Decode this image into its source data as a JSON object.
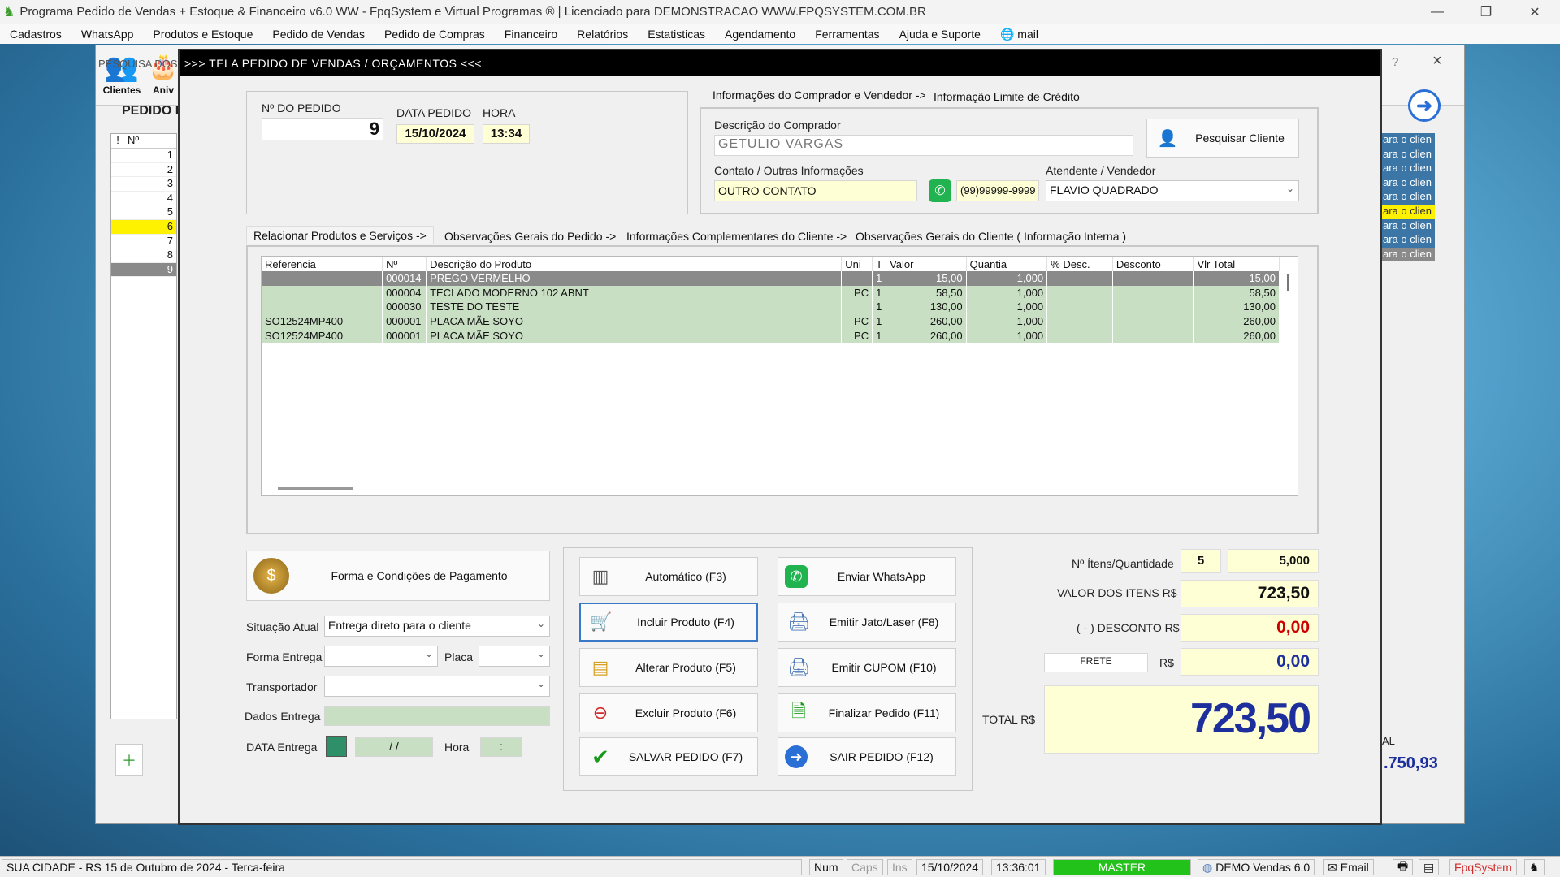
{
  "app": {
    "title": "Programa Pedido de Vendas + Estoque & Financeiro v6.0 WW - FpqSystem e Virtual Programas ® | Licenciado para  DEMONSTRACAO WWW.FPQSYSTEM.COM.BR",
    "menu": [
      "Cadastros",
      "WhatsApp",
      "Produtos e Estoque",
      "Pedido de Vendas",
      "Pedido de Compras",
      "Financeiro",
      "Relatórios",
      "Estatisticas",
      "Agendamento",
      "Ferramentas",
      "Ajuda e Suporte",
      "mail"
    ]
  },
  "background_window": {
    "toolbar": {
      "clientes": "Clientes",
      "aniv": "Aniv"
    },
    "search_label": "PESQUISA DOS",
    "pedido_label": "PEDIDO D",
    "list_header": [
      "!",
      "Nº"
    ],
    "list_numbers": [
      "1",
      "2",
      "3",
      "4",
      "5",
      "6",
      "7",
      "8",
      "9"
    ],
    "right_list": [
      "ara o clien",
      "ara o clien",
      "ara o clien",
      "ara o clien",
      "ara o clien",
      "ara o clien",
      "ara o clien",
      "ara o clien",
      "ara o clien"
    ],
    "total_label": "AL",
    "total_value": ".750,93",
    "help": "?",
    "close": "×"
  },
  "dialog": {
    "title": ">>>   TELA PEDIDO DE VENDAS / ORÇAMENTOS   <<<",
    "order": {
      "num_label": "Nº DO PEDIDO",
      "num_value": "9",
      "date_label": "DATA PEDIDO",
      "date_value": "15/10/2024",
      "hour_label": "HORA",
      "hour_value": "13:34"
    },
    "buyer_tabs": [
      "Informações do Comprador e Vendedor ->",
      "Informação Limite de Crédito"
    ],
    "buyer": {
      "desc_label": "Descrição do Comprador",
      "desc_value": "GETULIO VARGAS",
      "search_btn": "Pesquisar Cliente",
      "contact_label": "Contato / Outras Informações",
      "contact_value": "OUTRO CONTATO",
      "phone": "(99)99999-9999",
      "seller_label": "Atendente / Vendedor",
      "seller_value": "FLAVIO QUADRADO"
    },
    "tabs": [
      "Relacionar Produtos e Serviços ->",
      "Observações Gerais do Pedido ->",
      "Informações Complementares do Cliente ->",
      "Observações Gerais do Cliente ( Informação Interna )"
    ],
    "grid": {
      "columns": [
        "Referencia",
        "Nº",
        "Descrição do Produto",
        "Uni",
        "T",
        "Valor",
        "Quantia",
        "% Desc.",
        "Desconto",
        "Vlr Total"
      ],
      "rows": [
        {
          "ref": "",
          "num": "000014",
          "desc": "PREGO VERMELHO",
          "uni": "",
          "t": "1",
          "valor": "15,00",
          "qtd": "1,000",
          "pdesc": "",
          "desconto": "",
          "total": "15,00"
        },
        {
          "ref": "",
          "num": "000004",
          "desc": "TECLADO MODERNO 102 ABNT",
          "uni": "PC",
          "t": "1",
          "valor": "58,50",
          "qtd": "1,000",
          "pdesc": "",
          "desconto": "",
          "total": "58,50"
        },
        {
          "ref": "",
          "num": "000030",
          "desc": "TESTE DO TESTE",
          "uni": "",
          "t": "1",
          "valor": "130,00",
          "qtd": "1,000",
          "pdesc": "",
          "desconto": "",
          "total": "130,00"
        },
        {
          "ref": "SO12524MP400",
          "num": "000001",
          "desc": "PLACA MÃE SOYO",
          "uni": "PC",
          "t": "1",
          "valor": "260,00",
          "qtd": "1,000",
          "pdesc": "",
          "desconto": "",
          "total": "260,00"
        },
        {
          "ref": "SO12524MP400",
          "num": "000001",
          "desc": "PLACA MÃE SOYO",
          "uni": "PC",
          "t": "1",
          "valor": "260,00",
          "qtd": "1,000",
          "pdesc": "",
          "desconto": "",
          "total": "260,00"
        }
      ]
    },
    "payment": {
      "btn": "Forma e Condições de Pagamento",
      "situacao_label": "Situação Atual",
      "situacao_value": "Entrega direto para o cliente",
      "forma_label": "Forma Entrega",
      "forma_value": "",
      "placa_label": "Placa",
      "placa_value": "",
      "transp_label": "Transportador",
      "transp_value": "",
      "dados_label": "Dados Entrega",
      "data_label": "DATA Entrega",
      "data_value": " / /",
      "hora_label": "Hora",
      "hora_value": ":"
    },
    "actions": {
      "auto": "Automático   (F3)",
      "incluir": "Incluir Produto  (F4)",
      "alterar": "Alterar Produto   (F5)",
      "excluir": "Excluir Produto   (F6)",
      "salvar": "SALVAR PEDIDO (F7)",
      "whatsapp": "Enviar WhatsApp",
      "jato": "Emitir Jato/Laser (F8)",
      "cupom": "Emitir CUPOM   (F10)",
      "finalizar": "Finalizar Pedido  (F11)",
      "sair": "SAIR  PEDIDO   (F12)"
    },
    "totals": {
      "itens_label": "Nº Ítens/Quantidade",
      "itens_count": "5",
      "itens_qty": "5,000",
      "valor_label": "VALOR DOS ITENS R$",
      "valor_value": "723,50",
      "desconto_label": "( - ) DESCONTO R$",
      "desconto_value": "0,00",
      "frete_label": "FRETE",
      "frete_currency": "R$",
      "frete_value": "0,00",
      "total_label": "TOTAL R$",
      "total_value": "723,50"
    }
  },
  "statusbar": {
    "city": "SUA CIDADE - RS 15 de Outubro de 2024 - Terca-feira",
    "num": "Num",
    "caps": "Caps",
    "ins": "Ins",
    "date": "15/10/2024",
    "time": "13:36:01",
    "user": "MASTER",
    "version": "DEMO Vendas 6.0",
    "email": "Email",
    "brand": "FpqSystem"
  },
  "colors": {
    "accent_blue": "#1c2f9c",
    "red_value": "#cc0000",
    "dialog_title_bg": "#000000",
    "grid_row": "#c9dfc4",
    "highlight_yellow": "#ffffd6",
    "master_green": "#22c21a"
  }
}
